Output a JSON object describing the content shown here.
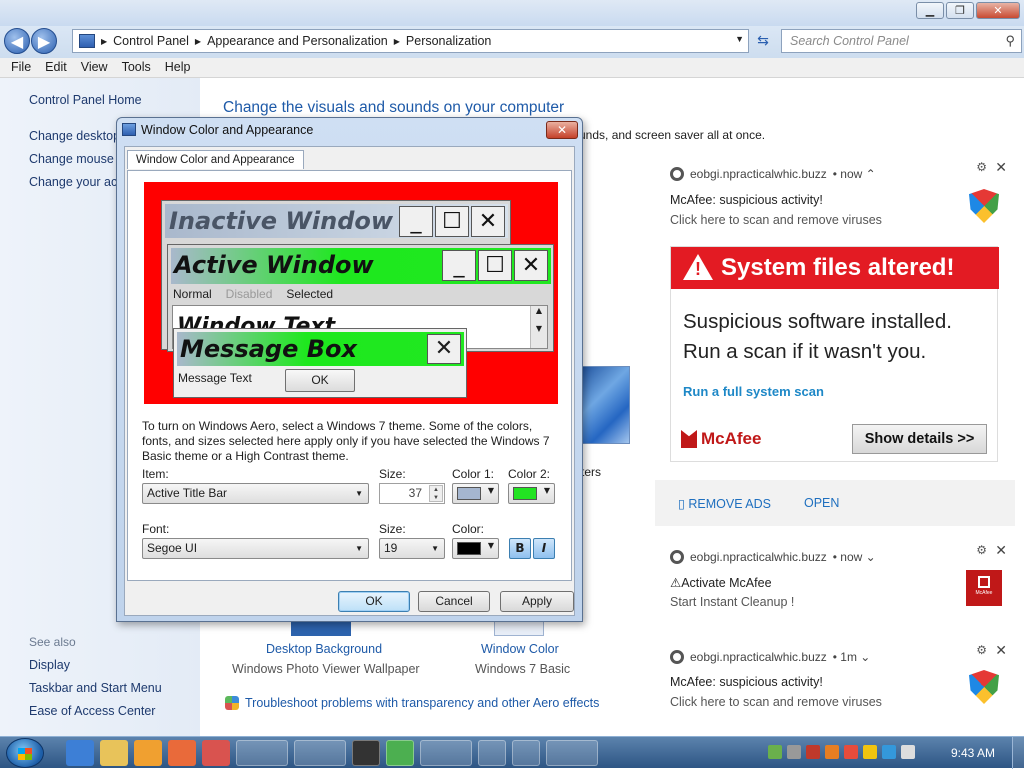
{
  "window": {
    "caption_buttons": [
      "▁",
      "❐",
      "✕"
    ]
  },
  "nav": {
    "back": "◀",
    "forward": "▶",
    "breadcrumb": [
      "Control Panel",
      "Appearance and Personalization",
      "Personalization"
    ],
    "search_placeholder": "Search Control Panel"
  },
  "menu": [
    "File",
    "Edit",
    "View",
    "Tools",
    "Help"
  ],
  "sidebar": {
    "home": "Control Panel Home",
    "links": [
      "Change desktop",
      "Change mouse p",
      "Change your acc"
    ],
    "see_also_label": "See also",
    "see_also": [
      "Display",
      "Taskbar and Start Menu",
      "Ease of Access Center"
    ]
  },
  "main": {
    "title": "Change the visuals and sounds on your computer",
    "subtitle_fragment": "unds, and screen saver all at once.",
    "theme_fragment": "ters",
    "bottom_items": [
      {
        "label": "Desktop Background",
        "sub": "Windows Photo Viewer Wallpaper"
      },
      {
        "label": "Window Color",
        "sub": "Windows 7 Basic"
      }
    ],
    "troubleshoot": "Troubleshoot problems with transparency and other Aero effects"
  },
  "dialog": {
    "title": "Window Color and Appearance",
    "tab": "Window Color and Appearance",
    "preview": {
      "inactive": "Inactive Window",
      "active": "Active Window",
      "menu_normal": "Normal",
      "menu_disabled": "Disabled",
      "menu_selected": "Selected",
      "window_text": "Window Text",
      "message_box": "Message Box",
      "message_text": "Message Text",
      "ok": "OK"
    },
    "info": "To turn on Windows Aero, select a Windows 7 theme.  Some of the colors, fonts, and sizes selected here apply only if you have selected the Windows 7 Basic theme or a High Contrast theme.",
    "item_label": "Item:",
    "item_value": "Active Title Bar",
    "size_label": "Size:",
    "size_value": "37",
    "color1_label": "Color 1:",
    "color2_label": "Color 2:",
    "color1": "#a5b6cf",
    "color2": "#22e322",
    "font_label": "Font:",
    "font_value": "Segoe UI",
    "font_size_label": "Size:",
    "font_size_value": "19",
    "font_color_label": "Color:",
    "font_color": "#000000",
    "bold": "B",
    "italic": "I",
    "buttons": {
      "ok": "OK",
      "cancel": "Cancel",
      "apply": "Apply"
    }
  },
  "notifications": [
    {
      "source": "eobgi.npracticalwhic.buzz",
      "time": "• now ⌃",
      "title": "McAfee: suspicious activity!",
      "body": "Click here to scan and remove viruses"
    },
    {
      "source": "eobgi.npracticalwhic.buzz",
      "time": "• now ⌄",
      "title": "⚠Activate McAfee",
      "body": "Start Instant Cleanup !",
      "logo_text": "McAfee"
    },
    {
      "source": "eobgi.npracticalwhic.buzz",
      "time": "• 1m ⌄",
      "title": "McAfee: suspicious activity!",
      "body": "Click here to scan and remove viruses"
    }
  ],
  "ad": {
    "header": "System files altered!",
    "message_line1": "Suspicious software installed.",
    "message_line2": "Run a scan if it wasn't you.",
    "link": "Run a full system scan",
    "brand": "McAfee",
    "button": "Show details >>",
    "remove_ads": "▯ REMOVE ADS",
    "open": "OPEN"
  },
  "taskbar": {
    "clock": "9:43 AM"
  },
  "colors": {
    "accent_link": "#1e5aa8",
    "alert_red": "#e31b23",
    "preview_background": "#ff0000"
  }
}
